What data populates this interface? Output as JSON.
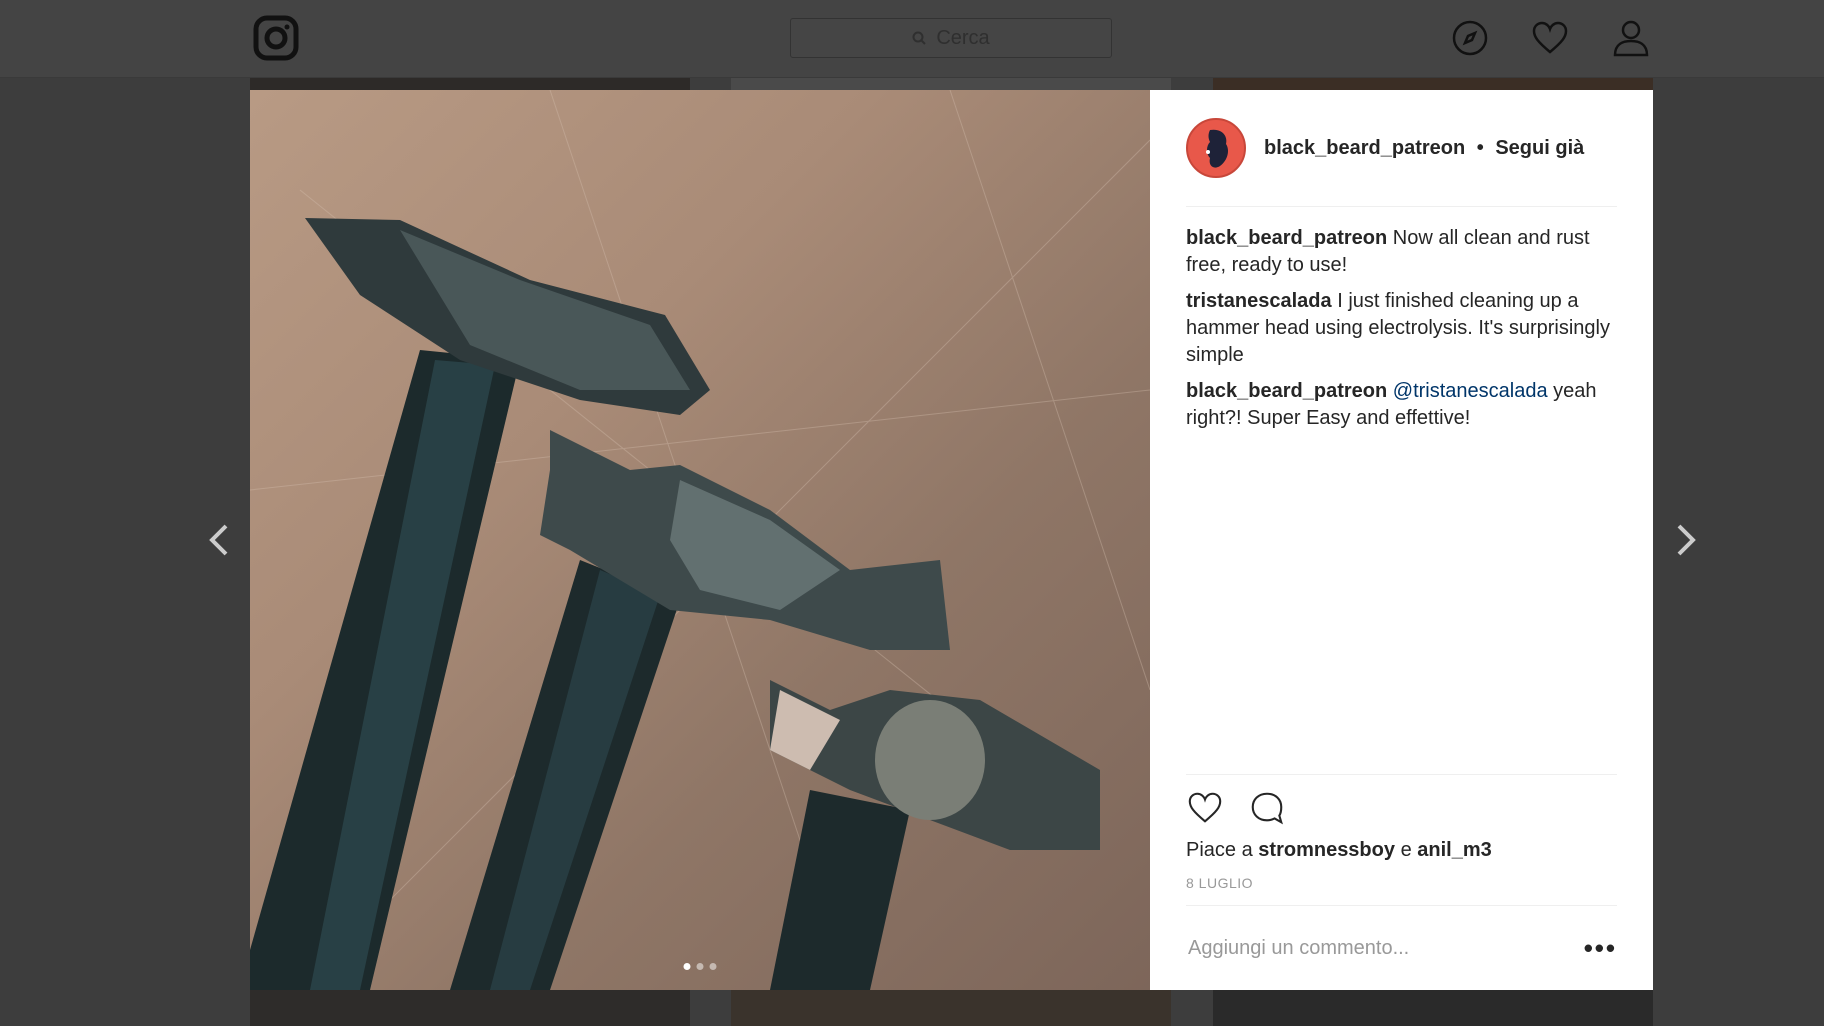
{
  "topbar": {
    "search_placeholder": "Cerca",
    "icons": [
      "instagram-logo-icon",
      "search-icon",
      "compass-icon",
      "heart-icon",
      "user-icon"
    ]
  },
  "post": {
    "author": "black_beard_patreon",
    "follow_status": "Segui già",
    "separator": "•",
    "comments": [
      {
        "user": "black_beard_patreon",
        "text": "Now all clean and rust free, ready to use!"
      },
      {
        "user": "tristanescalada",
        "text": "I just finished cleaning up a hammer head using electrolysis. It's surprisingly simple"
      },
      {
        "user": "black_beard_patreon",
        "mention": "@tristanescalada",
        "text": "yeah right?! Super Easy and effettive!"
      }
    ],
    "likes_prefix": "Piace a",
    "likers": [
      "stromnessboy",
      "anil_m3"
    ],
    "likes_conjunction": "e",
    "date": "8 LUGLIO",
    "add_comment_placeholder": "Aggiungi un commento...",
    "more_label": "•••",
    "carousel": {
      "count": 3,
      "active": 0
    }
  },
  "colors": {
    "overlay": "#3d3d3d",
    "mention": "#003569",
    "avatar": "#e8584a"
  }
}
